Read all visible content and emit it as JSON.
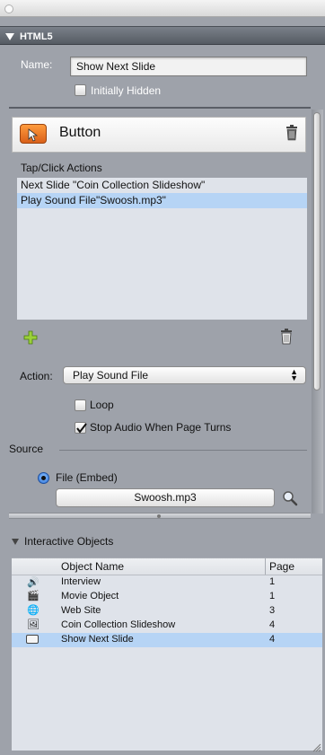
{
  "htmls_header": "HTML5",
  "name": {
    "label": "Name:",
    "value": "Show Next Slide"
  },
  "initially_hidden_label": "Initially Hidden",
  "widget_title": "Button",
  "tap_click": {
    "heading": "Tap/Click Actions",
    "items": [
      "Next Slide \"Coin Collection Slideshow\"",
      "Play Sound File\"Swoosh.mp3\""
    ],
    "selected_index": 1
  },
  "action": {
    "label": "Action:",
    "value": "Play Sound File"
  },
  "loop_label": "Loop",
  "stop_audio_label": "Stop Audio When Page Turns",
  "stop_audio_checked": true,
  "source": {
    "label": "Source",
    "file_embed_label": "File (Embed)",
    "file_value": "Swoosh.mp3"
  },
  "interactive_objects": {
    "header": "Interactive Objects",
    "columns": {
      "name": "Object Name",
      "page": "Page"
    },
    "rows": [
      {
        "icon": "speaker-icon",
        "name": "Interview",
        "page": "1"
      },
      {
        "icon": "film-icon",
        "name": "Movie Object",
        "page": "1"
      },
      {
        "icon": "globe-icon",
        "name": "Web Site",
        "page": "3"
      },
      {
        "icon": "gallery-icon",
        "name": "Coin Collection Slideshow",
        "page": "4"
      },
      {
        "icon": "button-icon",
        "name": "Show Next Slide",
        "page": "4"
      }
    ],
    "selected_index": 4
  }
}
